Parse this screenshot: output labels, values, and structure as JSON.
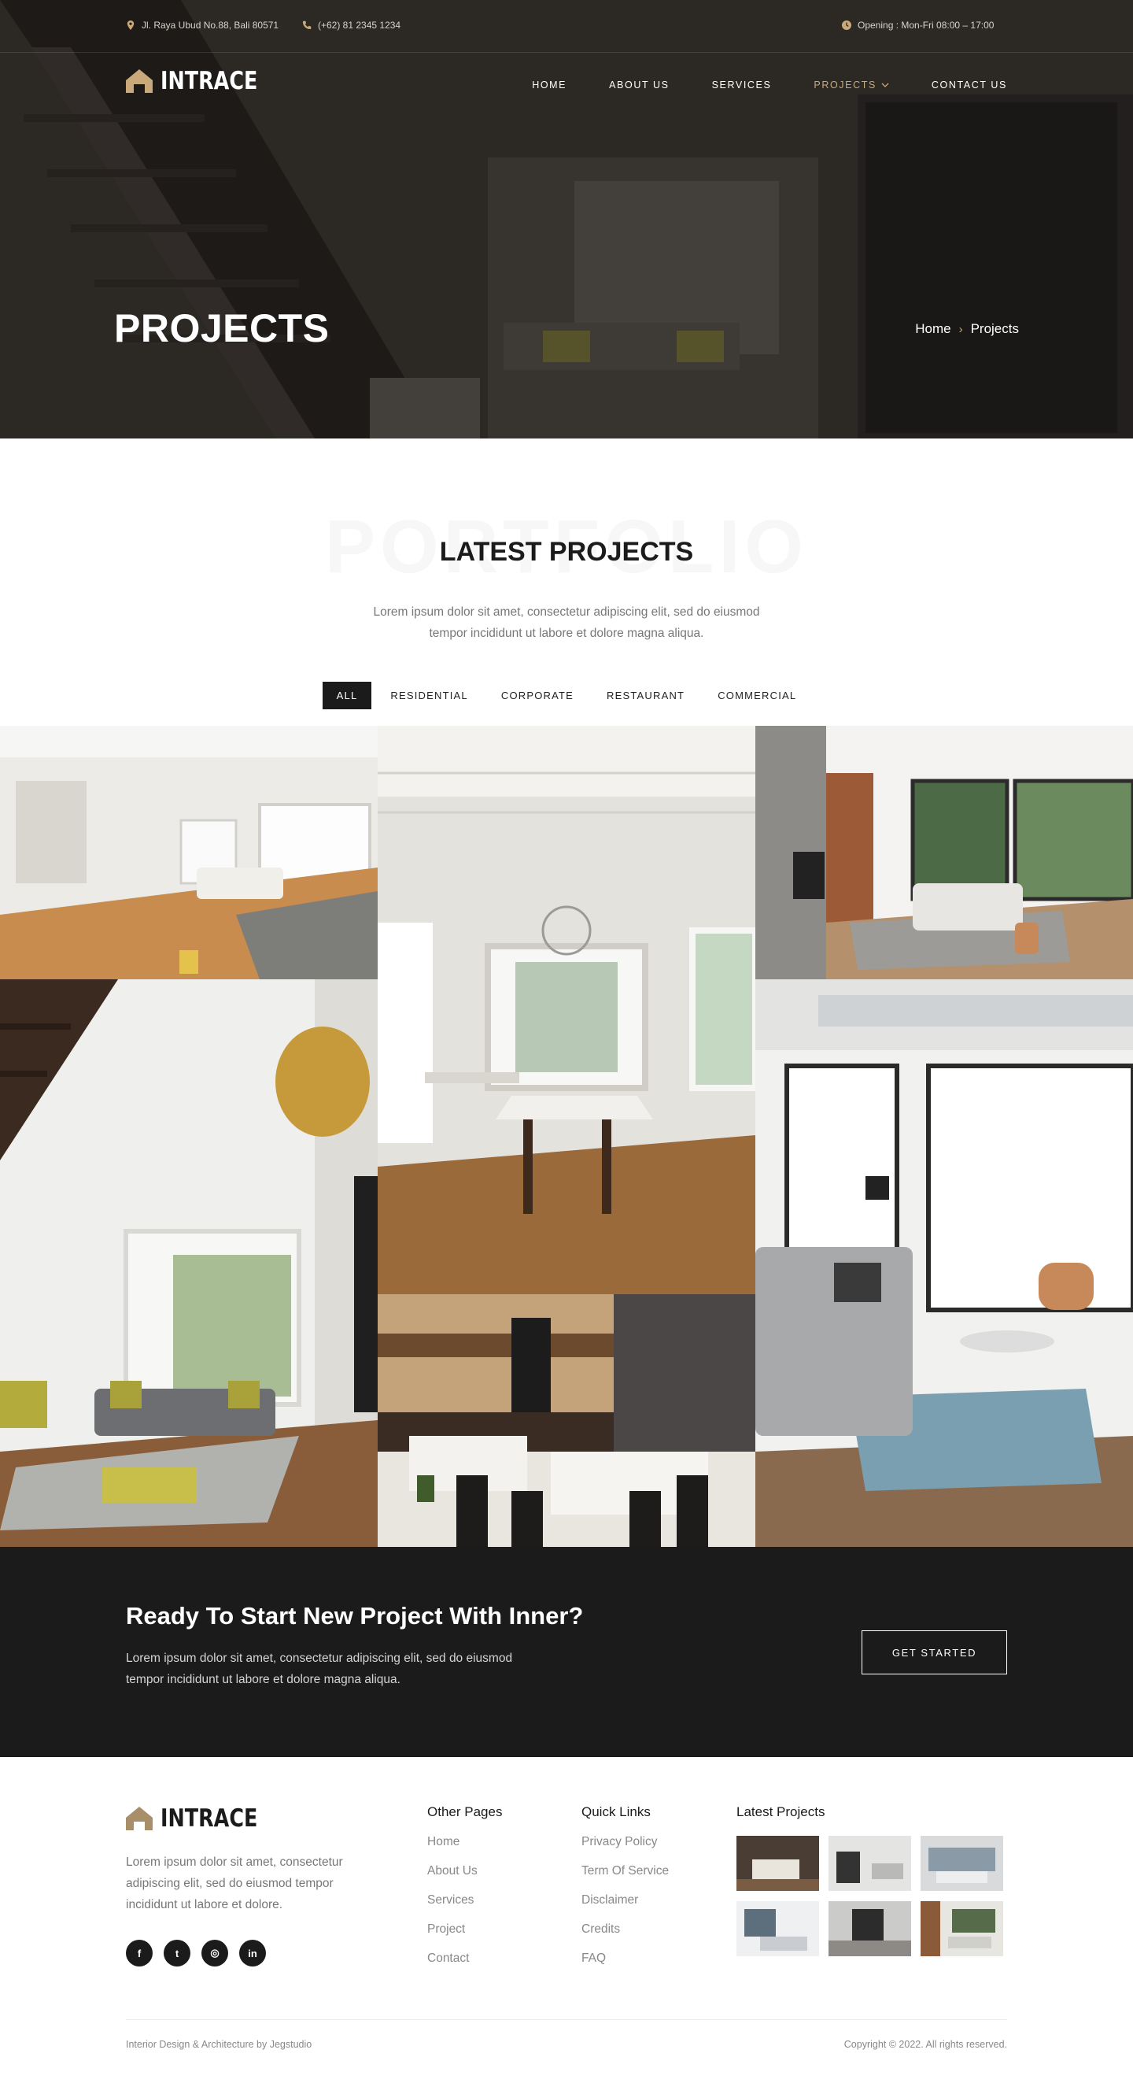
{
  "topbar": {
    "address": "Jl. Raya Ubud No.88, Bali 80571",
    "phone": "(+62) 81 2345 1234",
    "hours": "Opening : Mon-Fri 08:00 – 17:00"
  },
  "brand": {
    "name": "INTRACE",
    "accent": "#c9a97a"
  },
  "nav": {
    "items": [
      {
        "label": "HOME"
      },
      {
        "label": "ABOUT US"
      },
      {
        "label": "SERVICES"
      },
      {
        "label": "PROJECTS",
        "active": true
      },
      {
        "label": "CONTACT US"
      }
    ]
  },
  "hero": {
    "title": "PROJECTS",
    "breadcrumb": {
      "home": "Home",
      "current": "Projects"
    }
  },
  "projects": {
    "ghost_text": "PORTFOLIO",
    "title": "LATEST PROJECTS",
    "description": "Lorem ipsum dolor sit amet, consectetur adipiscing elit, sed do eiusmod tempor incididunt ut labore et dolore magna aliqua.",
    "filters": [
      "ALL",
      "RESIDENTIAL",
      "CORPORATE",
      "RESTAURANT",
      "COMMERCIAL"
    ],
    "active_filter": "ALL"
  },
  "cta": {
    "title": "Ready To Start New Project With Inner?",
    "text": "Lorem ipsum dolor sit amet, consectetur adipiscing elit, sed do eiusmod tempor incididunt ut labore et dolore magna aliqua.",
    "button": "GET STARTED"
  },
  "footer": {
    "about": "Lorem ipsum dolor sit amet, consectetur adipiscing elit, sed do eiusmod tempor incididunt ut labore et dolore.",
    "socials": [
      {
        "icon": "facebook-icon",
        "glyph": "f"
      },
      {
        "icon": "twitter-icon",
        "glyph": "t"
      },
      {
        "icon": "instagram-icon",
        "glyph": "◎"
      },
      {
        "icon": "linkedin-icon",
        "glyph": "in"
      }
    ],
    "other_pages": {
      "title": "Other Pages",
      "links": [
        "Home",
        "About Us",
        "Services",
        "Project",
        "Contact"
      ]
    },
    "quick_links": {
      "title": "Quick Links",
      "links": [
        "Privacy Policy",
        "Term Of Service",
        "Disclaimer",
        "Credits",
        "FAQ"
      ]
    },
    "latest_projects": {
      "title": "Latest Projects"
    },
    "credit": "Interior Design & Architecture by Jegstudio",
    "copyright": "Copyright © 2022. All rights reserved."
  }
}
